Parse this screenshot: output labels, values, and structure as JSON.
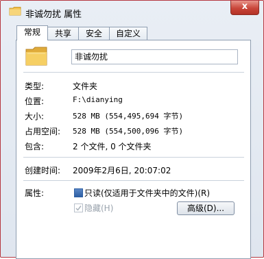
{
  "window": {
    "title": "非诚勿扰 属性",
    "close_label": "x"
  },
  "tabs": [
    {
      "label": "常规",
      "active": true
    },
    {
      "label": "共享",
      "active": false
    },
    {
      "label": "安全",
      "active": false
    },
    {
      "label": "自定义",
      "active": false
    }
  ],
  "general": {
    "folder_name": "非诚勿扰",
    "rows": [
      {
        "label": "类型:",
        "value": "文件夹"
      },
      {
        "label": "位置:",
        "value": "F:\\dianying"
      },
      {
        "label": "大小:",
        "value": "528 MB (554,495,694 字节)"
      },
      {
        "label": "占用空间:",
        "value": "528 MB (554,500,096 字节)"
      },
      {
        "label": "包含:",
        "value": "2 个文件, 0 个文件夹"
      }
    ],
    "created": {
      "label": "创建时间:",
      "value": "2009年2月6日, 20:07:02"
    },
    "attributes": {
      "label": "属性:",
      "readonly_label": "只读(仅适用于文件夹中的文件)(R)",
      "hidden_label": "隐藏(H)",
      "advanced_label": "高级(D)..."
    }
  },
  "colors": {
    "folder": "#f2c14e",
    "close": "#c9463a"
  },
  "icons": {
    "title": "folder-icon",
    "main": "folder-icon",
    "close": "close-icon"
  }
}
